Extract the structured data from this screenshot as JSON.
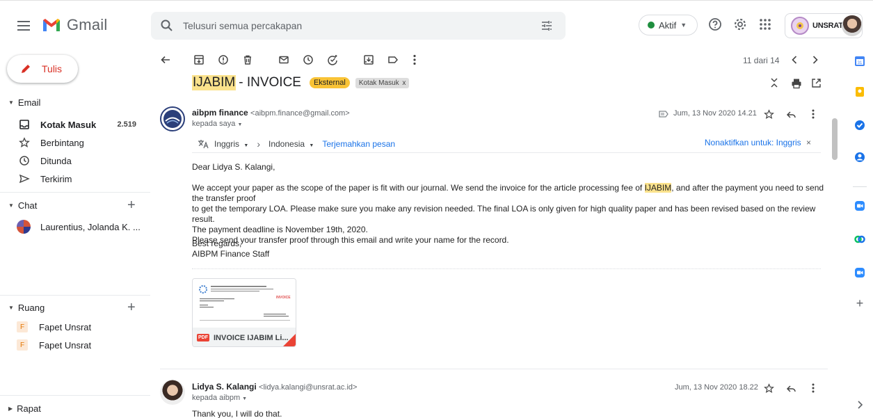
{
  "app": {
    "name": "Gmail"
  },
  "search": {
    "placeholder": "Telusuri semua percakapan"
  },
  "status": {
    "label": "Aktif"
  },
  "account": {
    "org": "UNSRAT"
  },
  "compose": {
    "label": "Tulis"
  },
  "sidebar": {
    "email_header": "Email",
    "items": [
      {
        "label": "Kotak Masuk",
        "count": "2.519"
      },
      {
        "label": "Berbintang"
      },
      {
        "label": "Ditunda"
      },
      {
        "label": "Terkirim"
      }
    ],
    "chat_header": "Chat",
    "chat_item": "Laurentius, Jolanda K. ...",
    "rooms_header": "Ruang",
    "rooms": [
      {
        "badge": "F",
        "label": "Fapet Unsrat"
      },
      {
        "badge": "F",
        "label": "Fapet Unsrat"
      }
    ],
    "meet_header": "Rapat"
  },
  "toolbar": {
    "pager": "11 dari 14"
  },
  "thread": {
    "subject_highlight": "IJABIM",
    "subject_rest": "- INVOICE",
    "badge_external": "Eksternal",
    "badge_label": "Kotak Masuk",
    "badge_close": "x"
  },
  "message1": {
    "sender_name": "aibpm finance",
    "sender_email": "<aibpm.finance@gmail.com>",
    "recipient": "kepada saya",
    "date": "Jum, 13 Nov 2020 14.21",
    "translate": {
      "from": "Inggris",
      "to": "Indonesia",
      "action": "Terjemahkan pesan",
      "off": "Nonaktifkan untuk: Inggris"
    },
    "greeting": "Dear Lidya S. Kalangi,",
    "p1a": "We accept your paper as the scope of the paper is fit with our journal. We send the invoice for the article processing fee of ",
    "p1hl": "IJABIM",
    "p1b": ", and after the payment you need to send the transfer proof",
    "p2": "to get the temporary LOA. Please make sure you make any revision needed. The final LOA is only given for high quality paper and has been revised based on the review result.",
    "p3": "The payment deadline is November 19th, 2020.",
    "p4": "Please send your transfer proof through this email and write your name for the record.",
    "closing1": "Best regards,",
    "closing2": "AIBPM Finance Staff",
    "attachment": {
      "type": "PDF",
      "name": "INVOICE IJABIM Li...",
      "preview_title": "INVOICE"
    }
  },
  "message2": {
    "sender_name": "Lidya S. Kalangi",
    "sender_email": "<lidya.kalangi@unsrat.ac.id>",
    "recipient": "kepada aibpm",
    "date": "Jum, 13 Nov 2020 18.22",
    "body": "Thank you, I will do that."
  }
}
